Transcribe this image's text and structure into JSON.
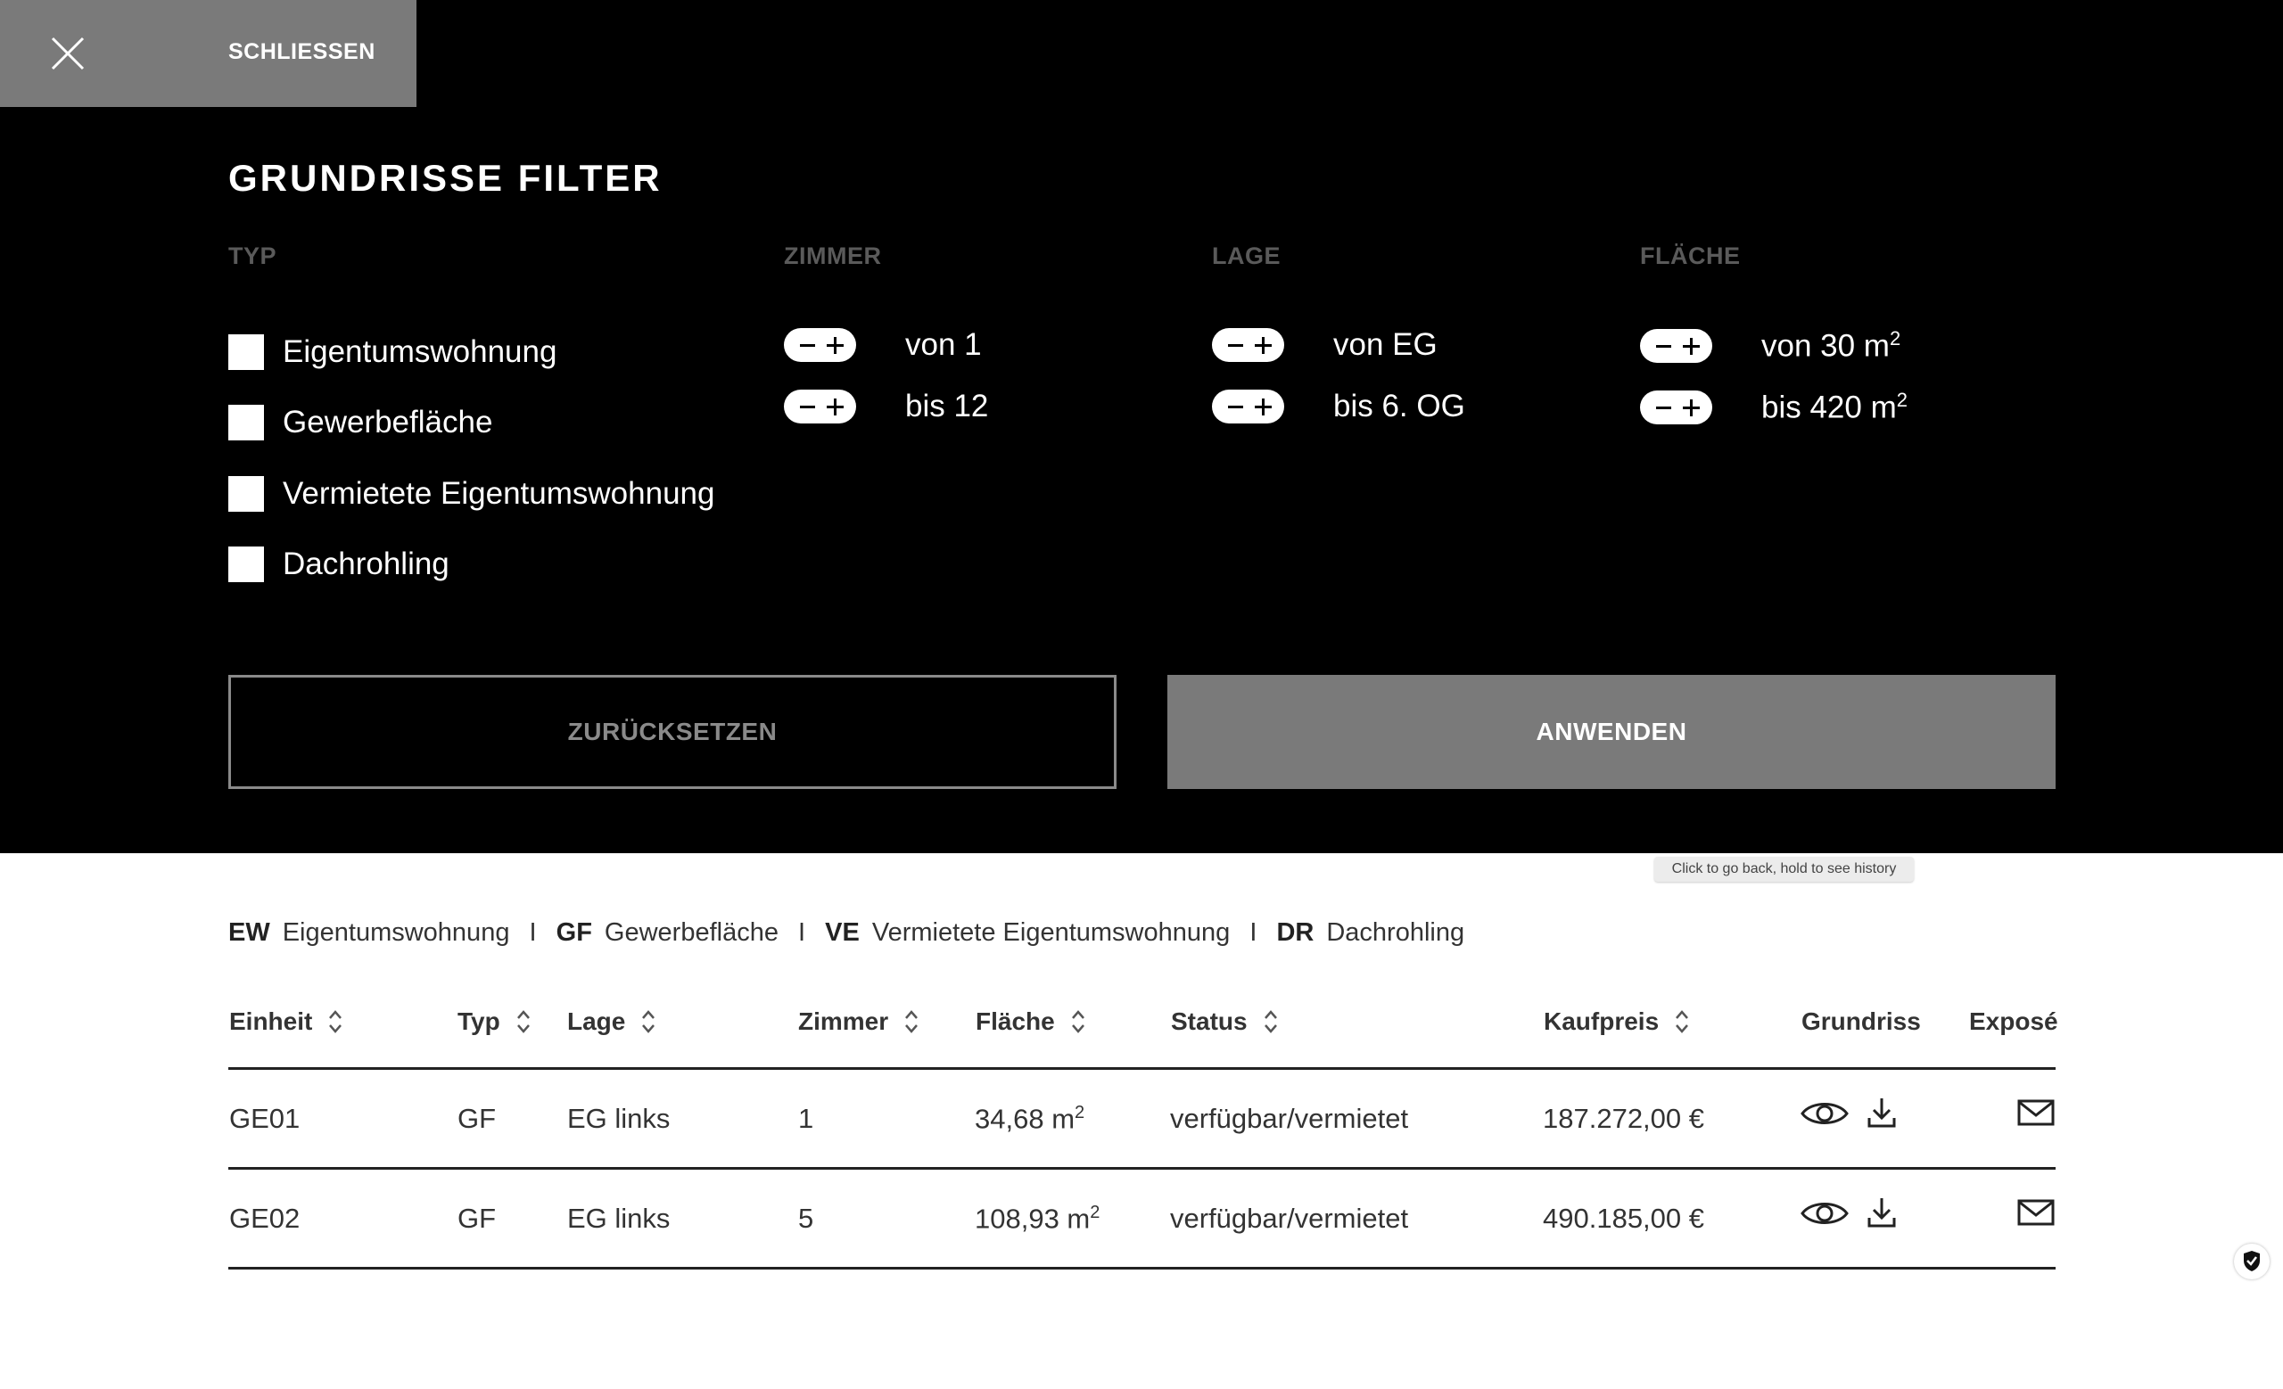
{
  "close": {
    "label": "SCHLIESSEN"
  },
  "title": "GRUNDRISSE FILTER",
  "filters": {
    "typ": {
      "heading": "TYP",
      "options": [
        "Eigentumswohnung",
        "Gewerbefläche",
        "Vermietete Eigentumswohnung",
        "Dachrohling"
      ]
    },
    "zimmer": {
      "heading": "ZIMMER",
      "from": "von 1",
      "to": "bis 12"
    },
    "lage": {
      "heading": "LAGE",
      "from": "von EG",
      "to": "bis 6. OG"
    },
    "flaeche": {
      "heading": "FLÄCHE",
      "from": "von 30 m",
      "to": "bis 420 m",
      "unit_exp": "2"
    }
  },
  "buttons": {
    "reset": "ZURÜCKSETZEN",
    "apply": "ANWENDEN"
  },
  "tooltip": "Click to go back, hold to see history",
  "legend": [
    {
      "code": "EW",
      "label": "Eigentumswohnung"
    },
    {
      "code": "GF",
      "label": "Gewerbefläche"
    },
    {
      "code": "VE",
      "label": "Vermietete Eigentumswohnung"
    },
    {
      "code": "DR",
      "label": "Dachrohling"
    }
  ],
  "legend_sep": "I",
  "table": {
    "headers": {
      "einheit": "Einheit",
      "typ": "Typ",
      "lage": "Lage",
      "zimmer": "Zimmer",
      "flaeche": "Fläche",
      "status": "Status",
      "kaufpreis": "Kaufpreis",
      "grundriss": "Grundriss",
      "expose": "Exposé"
    },
    "rows": [
      {
        "einheit": "GE01",
        "typ": "GF",
        "lage": "EG links",
        "zimmer": "1",
        "flaeche": "34,68 m",
        "status": "verfügbar/vermietet",
        "kaufpreis": "187.272,00 €"
      },
      {
        "einheit": "GE02",
        "typ": "GF",
        "lage": "EG links",
        "zimmer": "5",
        "flaeche": "108,93 m",
        "status": "verfügbar/vermietet",
        "kaufpreis": "490.185,00 €"
      }
    ]
  },
  "colors": {
    "panel": "#000000",
    "button_gray": "#7a7a7a",
    "heading_gray": "#5a5a5a",
    "text_dark": "#333333"
  }
}
